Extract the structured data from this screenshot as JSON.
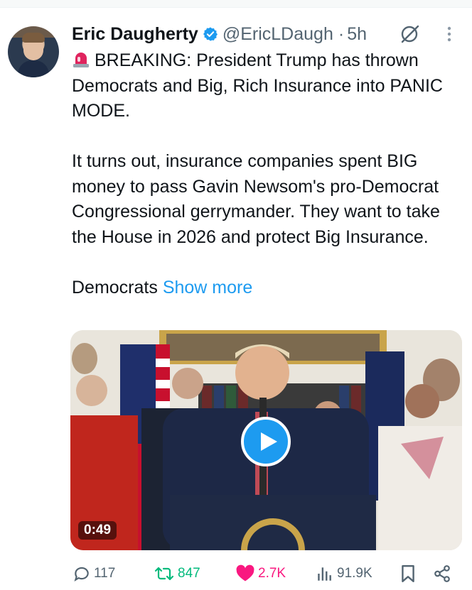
{
  "post": {
    "author_name": "Eric Daugherty",
    "handle": "@EricLDaugh",
    "separator": "·",
    "time": "5h",
    "text_p1": "BREAKING: President Trump has thrown Democrats and Big, Rich Insurance into PANIC MODE.",
    "text_p2": "It turns out, insurance companies spent BIG money to pass Gavin Newsom's pro-Democrat Congressional gerrymander. They want to take the House in 2026 and protect Big Insurance.",
    "text_p3": "Democrats",
    "show_more": "Show more"
  },
  "media": {
    "duration": "0:49"
  },
  "actions": {
    "replies": "117",
    "reposts": "847",
    "likes": "2.7K",
    "views": "91.9K"
  },
  "colors": {
    "accent": "#1d9bf0",
    "repost": "#00ba7c",
    "like": "#f91880",
    "muted": "#536471"
  }
}
